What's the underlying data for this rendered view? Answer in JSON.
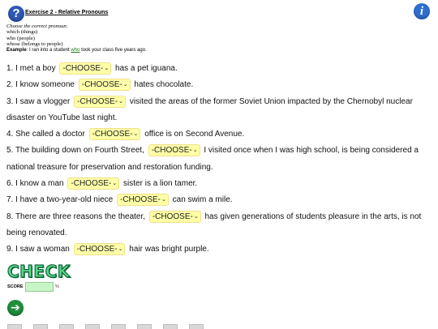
{
  "header": {
    "title": "Exercise 2 - Relative Pronouns",
    "help_glyph": "?",
    "info_glyph": "i"
  },
  "instructions": {
    "prompt": "Choose the correct pronoun:",
    "lines": [
      "which (things)",
      "who (people)",
      "whose (belongs to people)"
    ],
    "example_label": "Example",
    "example_before": ": I ran into a student ",
    "example_answer": "who",
    "example_after": " took your class five years ago."
  },
  "select_label": "-CHOOSE-",
  "select_arrow": "⌄",
  "questions": [
    {
      "number": "1.",
      "before": "I met a boy",
      "after": "has a pet iguana."
    },
    {
      "number": "2.",
      "before": "I know someone",
      "after": "hates chocolate."
    },
    {
      "number": "3.",
      "before": "I saw a vlogger",
      "after": "visited the areas of the former Soviet Union impacted by the Chernobyl nuclear disaster on YouTube last night."
    },
    {
      "number": "4.",
      "before": "She called a doctor",
      "after": "office is on Second Avenue."
    },
    {
      "number": "5.",
      "before": "The building down on Fourth Street,",
      "after": "I visited once when I was high school, is being considered a national treasure for preservation and restoration funding."
    },
    {
      "number": "6.",
      "before": "I know a man",
      "after": "sister is a lion tamer."
    },
    {
      "number": "7.",
      "before": "I have a two-year-old niece",
      "after": "can swim a mile."
    },
    {
      "number": "8.",
      "before": "There are three reasons the theater,",
      "after": "has given generations of students pleasure in the arts, is not being renovated."
    },
    {
      "number": "9.",
      "before": "I saw a woman",
      "after": "hair was bright purple."
    }
  ],
  "footer": {
    "check_label": "CHECK",
    "score_label": "SCORE",
    "score_value": "",
    "percent_sign": "%",
    "next_glyph": "➔"
  },
  "colors": {
    "select_bg": "#ffffa8",
    "check_green": "#5dd58a",
    "score_box": "#c8f5c8",
    "help_blue": "#2e57b8"
  }
}
